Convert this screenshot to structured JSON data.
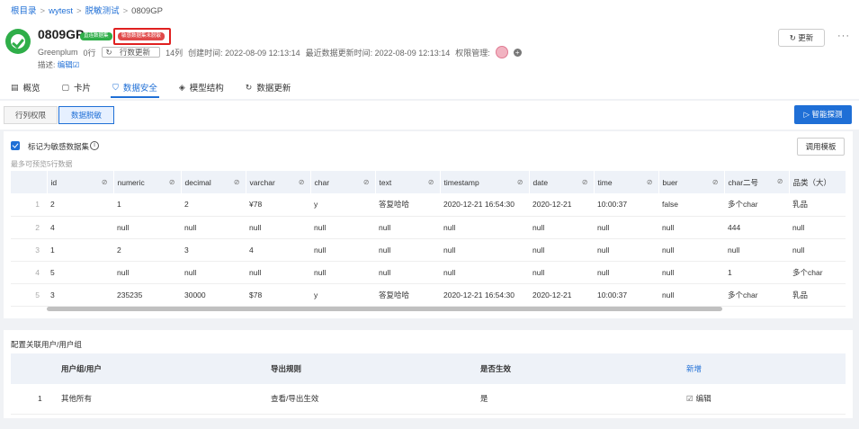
{
  "breadcrumb": [
    "根目录",
    "wytest",
    "脱敏测试",
    "0809GP"
  ],
  "header": {
    "title": "0809GP",
    "tag_direct": "直连数据集",
    "tag_sensitive": "敏感数据集未脱敏",
    "source": "Greenplum",
    "rows": "0行",
    "row_update": "行数更新",
    "cols": "14列",
    "created": "创建时间: 2022-08-09 12:13:14",
    "updated": "最近数据更新时间: 2022-08-09 12:13:14",
    "perm": "权限管理:",
    "desc_label": "描述:",
    "desc_edit": "编辑",
    "update_btn": "更新"
  },
  "tabs": [
    {
      "label": "概览",
      "icon": "overview-icon",
      "glyph": "▤"
    },
    {
      "label": "卡片",
      "icon": "card-icon",
      "glyph": "▢"
    },
    {
      "label": "数据安全",
      "icon": "shield-icon",
      "glyph": "⛉"
    },
    {
      "label": "模型结构",
      "icon": "cube-icon",
      "glyph": "◈"
    },
    {
      "label": "数据更新",
      "icon": "refresh-icon",
      "glyph": "↻"
    }
  ],
  "subtabs": [
    "行列权限",
    "数据脱敏"
  ],
  "scan_btn": "▷ 智能探测",
  "sensitive_check": "标记为敏感数据集",
  "template_btn": "调用模板",
  "preview_note": "最多可预览5行数据",
  "columns": [
    "id",
    "numeric",
    "decimal",
    "varchar",
    "char",
    "text",
    "timestamp",
    "date",
    "time",
    "buer",
    "char二号",
    "品类（大）"
  ],
  "rows": [
    [
      "1",
      "2",
      "1",
      "2",
      "¥78",
      "y",
      "答复哈哈",
      "2020-12-21 16:54:30",
      "2020-12-21",
      "10:00:37",
      "false",
      "多个char",
      "乳品"
    ],
    [
      "2",
      "4",
      "null",
      "null",
      "null",
      "null",
      "null",
      "null",
      "null",
      "null",
      "null",
      "444",
      "null"
    ],
    [
      "3",
      "1",
      "2",
      "3",
      "4",
      "null",
      "null",
      "null",
      "null",
      "null",
      "null",
      "null",
      "null"
    ],
    [
      "4",
      "5",
      "null",
      "null",
      "null",
      "null",
      "null",
      "null",
      "null",
      "null",
      "null",
      "1",
      "多个char"
    ],
    [
      "5",
      "3",
      "235235",
      "30000",
      "$78",
      "y",
      "答复哈哈",
      "2020-12-21 16:54:30",
      "2020-12-21",
      "10:00:37",
      "null",
      "多个char",
      "乳品"
    ]
  ],
  "config": {
    "title": "配置关联用户/用户组",
    "headers": [
      "用户组/用户",
      "导出规则",
      "是否生效",
      "新增"
    ],
    "row": {
      "index": "1",
      "user": "其他所有",
      "rule": "查看/导出生效",
      "effective": "是",
      "edit": "编辑"
    }
  },
  "colors": {
    "accent": "#1f6fd6",
    "green": "#2fae49",
    "red": "#e04a4a"
  }
}
